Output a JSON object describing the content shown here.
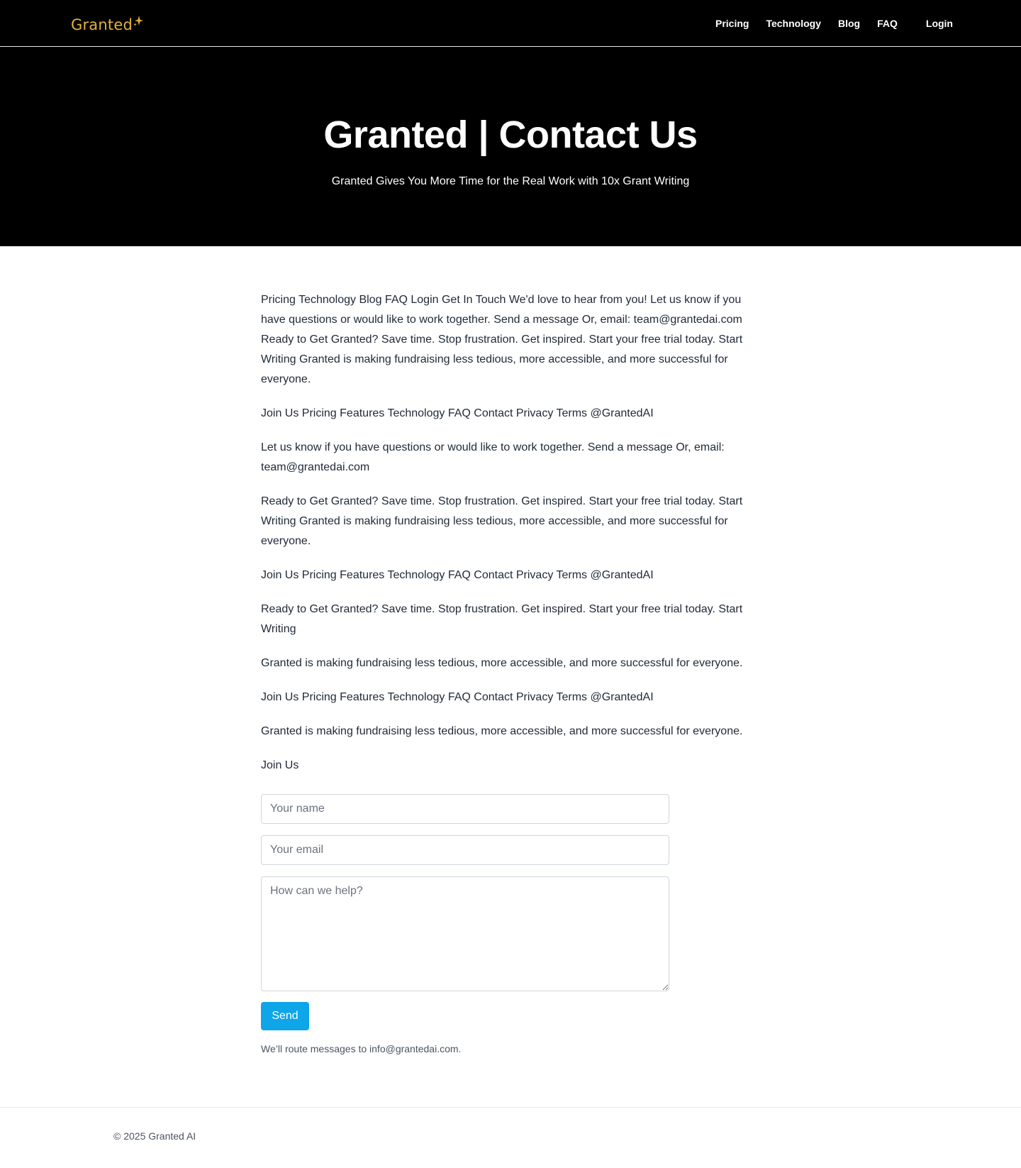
{
  "brand": {
    "name": "Granted",
    "accent_color": "#e3b23c",
    "spark_icon": "sparkle-icon"
  },
  "nav": {
    "items": [
      "Pricing",
      "Technology",
      "Blog",
      "FAQ"
    ],
    "login": "Login"
  },
  "hero": {
    "title": "Granted | Contact Us",
    "subtitle": "Granted Gives You More Time for the Real Work with 10x Grant Writing"
  },
  "content": {
    "paragraphs": [
      "Pricing Technology Blog FAQ Login Get In Touch We'd love to hear from you! Let us know if you have questions or would like to work together. Send a message Or, email: team@grantedai.com Ready to Get Granted? Save time. Stop frustration. Get inspired. Start your free trial today. Start Writing Granted is making fundraising less tedious, more accessible, and more successful for everyone.",
      "Join Us Pricing Features Technology FAQ Contact Privacy Terms @GrantedAI",
      "Let us know if you have questions or would like to work together. Send a message Or, email: team@grantedai.com",
      "Ready to Get Granted? Save time. Stop frustration. Get inspired. Start your free trial today. Start Writing Granted is making fundraising less tedious, more accessible, and more successful for everyone.",
      "Join Us Pricing Features Technology FAQ Contact Privacy Terms @GrantedAI",
      "Ready to Get Granted? Save time. Stop frustration. Get inspired. Start your free trial today. Start Writing",
      "Granted is making fundraising less tedious, more accessible, and more successful for everyone.",
      "Join Us Pricing Features Technology FAQ Contact Privacy Terms @GrantedAI",
      "Granted is making fundraising less tedious, more accessible, and more successful for everyone.",
      "Join Us"
    ]
  },
  "form": {
    "name_placeholder": "Your name",
    "email_placeholder": "Your email",
    "message_placeholder": "How can we help?",
    "send_label": "Send",
    "send_color": "#0ea5e9",
    "route_note": "We’ll route messages to info@grantedai.com."
  },
  "footer": {
    "copyright": "© 2025 Granted AI"
  }
}
